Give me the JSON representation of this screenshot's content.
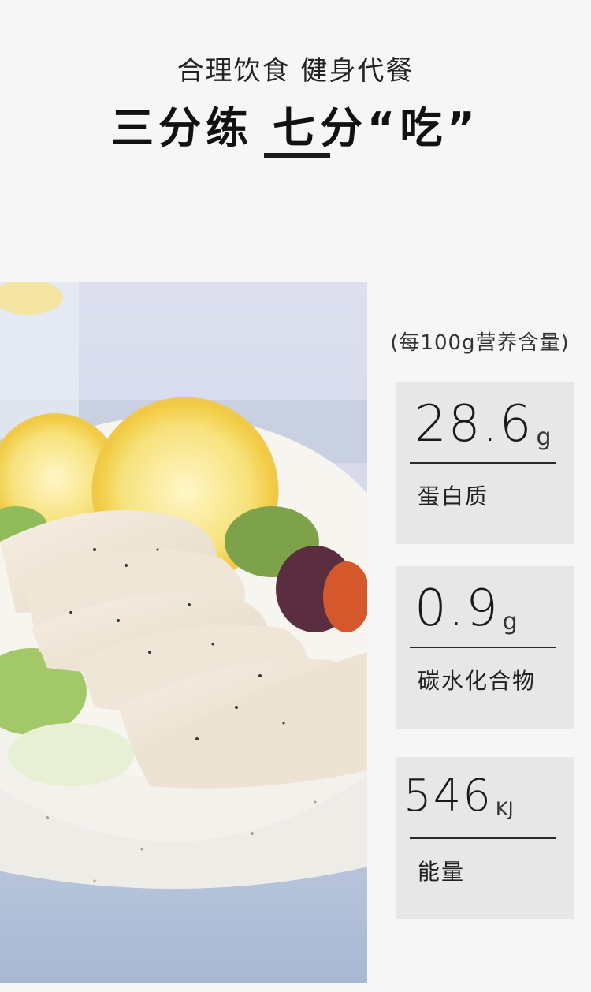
{
  "header": {
    "subtitle": "合理饮食 健身代餐",
    "title": "三分练 七分“吃”"
  },
  "nutrition": {
    "caption": "(每100g营养含量)",
    "items": [
      {
        "value": "28.6",
        "unit": "g",
        "label": "蛋白质"
      },
      {
        "value": "0.9",
        "unit": "g",
        "label": "碳水化合物"
      },
      {
        "value": "546",
        "unit": "KJ",
        "label": "能量"
      }
    ]
  },
  "colors": {
    "background": "#f6f6f6",
    "card": "#e7e7e7",
    "text": "#1a1a1a"
  }
}
